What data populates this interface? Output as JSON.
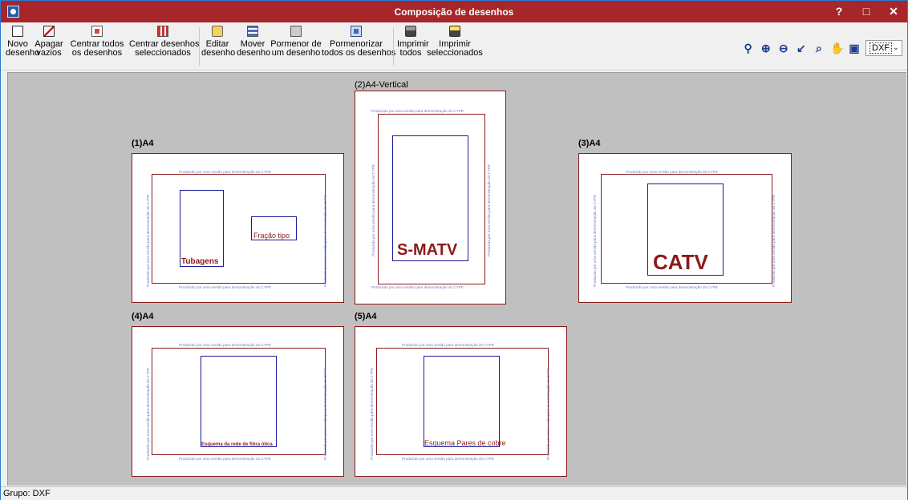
{
  "window": {
    "title": "Composição de desenhos",
    "help_label": "?",
    "maximize_label": "□",
    "close_label": "✕"
  },
  "toolbar": {
    "tools": [
      {
        "label": "Novo\ndesenho",
        "icon": "new-document-icon"
      },
      {
        "label": "Apagar\nvazios",
        "icon": "erase-empty-icon"
      },
      {
        "label": "Centrar todos\nos desenhos",
        "icon": "center-all-icon"
      },
      {
        "label": "Centrar desenhos\nseleccionados",
        "icon": "center-selected-icon"
      },
      {
        "label": "Editar\ndesenho",
        "icon": "edit-drawing-icon"
      },
      {
        "label": "Mover\ndesenho",
        "icon": "move-drawing-icon"
      },
      {
        "label": "Pormenor de\num desenho",
        "icon": "detail-drawing-icon"
      },
      {
        "label": "Pormenorizar\ntodos os desenhos",
        "icon": "detail-all-icon"
      },
      {
        "label": "Imprimir\ntodos",
        "icon": "print-all-icon"
      },
      {
        "label": "Imprimir\nseleccionados",
        "icon": "print-selected-icon"
      }
    ],
    "format_select": {
      "value": "DXF"
    }
  },
  "watermark": "Produzido por uma versão para demonstração do CYPE",
  "sheets": [
    {
      "label": "(1)A4",
      "drawings": [
        "Tubagens",
        "Fração tipo"
      ]
    },
    {
      "label": "(2)A4-Vertical",
      "drawings": [
        "S-MATV"
      ]
    },
    {
      "label": "(3)A4",
      "drawings": [
        "CATV"
      ]
    },
    {
      "label": "(4)A4",
      "drawings": [
        "Esquema da rede de fibra ótica"
      ]
    },
    {
      "label": "(5)A4",
      "drawings": [
        "Esquema Pares de cobre"
      ]
    }
  ],
  "status": {
    "text": "Grupo: DXF"
  },
  "colors": {
    "titlebar": "#a6262a",
    "canvas": "#c0c0c0",
    "sheet_border": "#8b1a1a",
    "drawing_border": "#1a1a9a",
    "watermark": "#6a7cc8"
  }
}
